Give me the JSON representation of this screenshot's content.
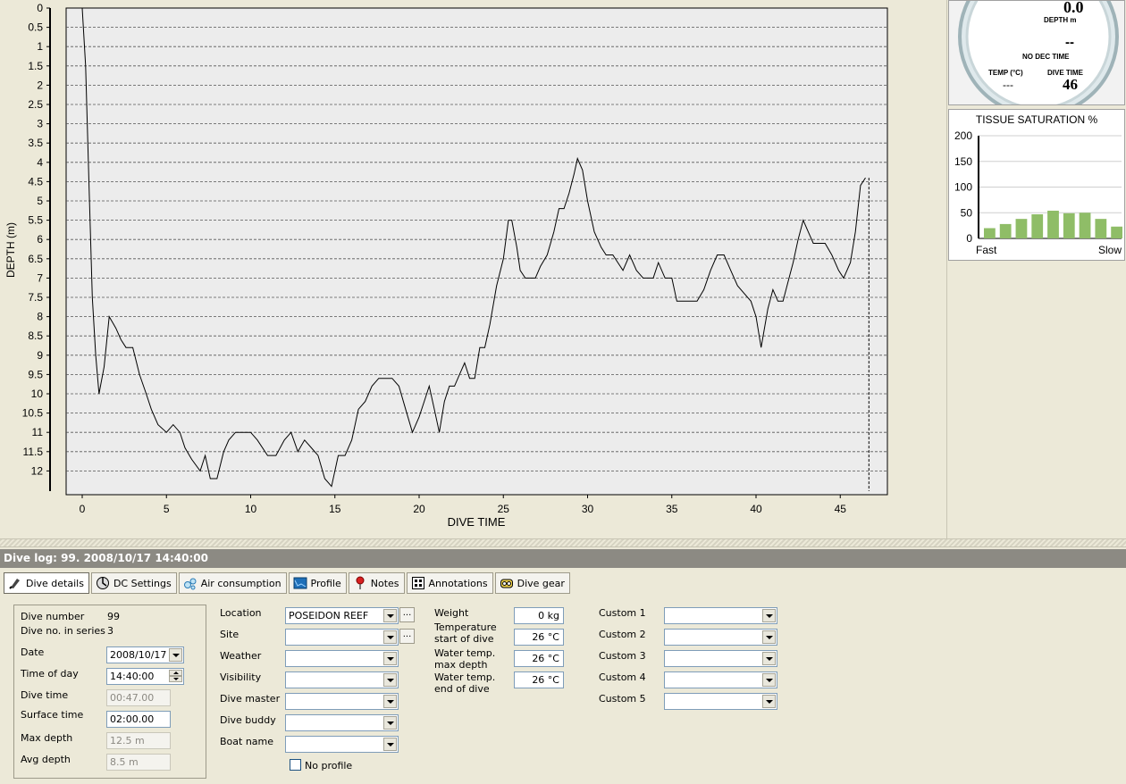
{
  "profile_chart": {
    "ylabel": "DEPTH (m)",
    "xlabel": "DIVE TIME",
    "ylim": [
      0,
      12.5
    ],
    "xlim": [
      -1,
      48
    ],
    "y_ticks": [
      "0",
      "0.5",
      "1",
      "1.5",
      "2",
      "2.5",
      "3",
      "3.5",
      "4",
      "4.5",
      "5",
      "5.5",
      "6",
      "6.5",
      "7",
      "7.5",
      "8",
      "8.5",
      "9",
      "9.5",
      "10",
      "10.5",
      "11",
      "11.5",
      "12"
    ],
    "x_ticks": [
      "0",
      "5",
      "10",
      "15",
      "20",
      "25",
      "30",
      "35",
      "40",
      "45"
    ],
    "fill_color": "#8f8ff0",
    "line_color": "#000000"
  },
  "chart_data": [
    {
      "type": "area",
      "title": "",
      "xlabel": "DIVE TIME",
      "ylabel": "DEPTH (m)",
      "ylim": [
        0,
        12.5
      ],
      "xlim": [
        0,
        47
      ],
      "x": [
        0.0,
        0.2,
        0.4,
        0.6,
        0.8,
        1.0,
        1.3,
        1.6,
        2.0,
        2.3,
        2.6,
        3.0,
        3.4,
        3.8,
        4.1,
        4.5,
        5.0,
        5.4,
        5.8,
        6.1,
        6.5,
        7.0,
        7.3,
        7.6,
        8.0,
        8.4,
        8.7,
        9.1,
        9.6,
        10.0,
        10.4,
        11.0,
        11.5,
        12.0,
        12.4,
        12.8,
        13.2,
        13.6,
        14.0,
        14.4,
        14.8,
        15.2,
        15.6,
        16.0,
        16.4,
        16.8,
        17.2,
        17.6,
        18.0,
        18.4,
        18.8,
        19.2,
        19.6,
        20.0,
        20.3,
        20.6,
        20.9,
        21.2,
        21.5,
        21.8,
        22.1,
        22.4,
        22.7,
        23.0,
        23.3,
        23.6,
        23.9,
        24.2,
        24.6,
        25.0,
        25.3,
        25.5,
        25.8,
        26.0,
        26.3,
        26.6,
        26.9,
        27.2,
        27.6,
        28.0,
        28.3,
        28.6,
        28.9,
        29.2,
        29.4,
        29.7,
        30.0,
        30.4,
        30.8,
        31.1,
        31.5,
        31.8,
        32.1,
        32.5,
        32.9,
        33.3,
        33.6,
        33.9,
        34.2,
        34.6,
        35.0,
        35.3,
        35.7,
        36.1,
        36.5,
        36.9,
        37.3,
        37.7,
        38.1,
        38.5,
        38.9,
        39.3,
        39.7,
        40.0,
        40.3,
        40.7,
        41.0,
        41.3,
        41.6,
        41.9,
        42.2,
        42.5,
        42.8,
        43.1,
        43.4,
        43.8,
        44.1,
        44.5,
        44.9,
        45.2,
        45.6,
        45.9,
        46.2,
        46.5,
        46.7
      ],
      "y": [
        0.0,
        1.5,
        4.5,
        7.5,
        9.0,
        10.0,
        9.3,
        8.0,
        8.3,
        8.6,
        8.8,
        8.8,
        9.5,
        10.0,
        10.4,
        10.8,
        11.0,
        10.8,
        11.0,
        11.4,
        11.7,
        12.0,
        11.6,
        12.2,
        12.2,
        11.5,
        11.2,
        11.0,
        11.0,
        11.0,
        11.2,
        11.6,
        11.6,
        11.2,
        11.0,
        11.5,
        11.2,
        11.4,
        11.6,
        12.2,
        12.4,
        11.6,
        11.6,
        11.2,
        10.4,
        10.2,
        9.8,
        9.6,
        9.6,
        9.6,
        9.8,
        10.4,
        11.0,
        10.6,
        10.2,
        9.8,
        10.4,
        11.0,
        10.2,
        9.8,
        9.8,
        9.5,
        9.2,
        9.6,
        9.6,
        8.8,
        8.8,
        8.2,
        7.2,
        6.5,
        5.5,
        5.5,
        6.2,
        6.8,
        7.0,
        7.0,
        7.0,
        6.7,
        6.4,
        5.8,
        5.2,
        5.2,
        4.8,
        4.3,
        3.9,
        4.2,
        5.0,
        5.8,
        6.2,
        6.4,
        6.4,
        6.6,
        6.8,
        6.4,
        6.8,
        7.0,
        7.0,
        7.0,
        6.6,
        7.0,
        7.0,
        7.6,
        7.6,
        7.6,
        7.6,
        7.3,
        6.8,
        6.4,
        6.4,
        6.8,
        7.2,
        7.4,
        7.6,
        8.0,
        8.8,
        7.8,
        7.3,
        7.6,
        7.6,
        7.1,
        6.6,
        6.0,
        5.5,
        5.8,
        6.1,
        6.1,
        6.1,
        6.4,
        6.8,
        7.0,
        6.6,
        5.8,
        4.6,
        4.4
      ]
    },
    {
      "type": "bar",
      "title": "TISSUE SATURATION %",
      "ylim": [
        0,
        200
      ],
      "categories": [
        "1",
        "2",
        "3",
        "4",
        "5",
        "6",
        "7",
        "8",
        "9"
      ],
      "values": [
        20,
        28,
        38,
        47,
        54,
        49,
        50,
        38,
        23
      ],
      "xlabel_left": "Fast",
      "xlabel_right": "Slow",
      "y_ticks": [
        "200",
        "150",
        "100",
        "50",
        "0"
      ],
      "bar_color": "#8fbd67"
    }
  ],
  "gauge": {
    "depth_value": "0.0",
    "depth_label": "DEPTH",
    "depth_unit": "m",
    "no_dec_value": "--",
    "no_dec_label": "NO DEC TIME",
    "temp_label": "TEMP (°C)",
    "temp_value": "---",
    "dive_time_label": "DIVE TIME",
    "dive_time_value": "46"
  },
  "tissue": {
    "title": "TISSUE SATURATION %",
    "fast": "Fast",
    "slow": "Slow"
  },
  "log_title": "Dive log: 99. 2008/10/17 14:40:00",
  "tabs": [
    {
      "label": "Dive details",
      "icon": "fin-icon"
    },
    {
      "label": "DC Settings",
      "icon": "dive-computer-icon"
    },
    {
      "label": "Air consumption",
      "icon": "bubbles-icon"
    },
    {
      "label": "Profile",
      "icon": "profile-icon"
    },
    {
      "label": "Notes",
      "icon": "pin-icon"
    },
    {
      "label": "Annotations",
      "icon": "annotations-icon"
    },
    {
      "label": "Dive gear",
      "icon": "mask-icon"
    }
  ],
  "details": {
    "dive_number_label": "Dive number",
    "dive_number": "99",
    "series_label": "Dive no. in series",
    "series": "3",
    "date_label": "Date",
    "date": "2008/10/17",
    "time_label": "Time of day",
    "time": "14:40:00",
    "dive_time_label": "Dive time",
    "dive_time": "00:47.00",
    "surface_label": "Surface time",
    "surface": "02:00.00",
    "max_depth_label": "Max depth",
    "max_depth": "12.5 m",
    "avg_depth_label": "Avg depth",
    "avg_depth": "8.5 m",
    "location_label": "Location",
    "location": "POSEIDON REEF",
    "site_label": "Site",
    "site": "",
    "weather_label": "Weather",
    "weather": "",
    "visibility_label": "Visibility",
    "visibility": "",
    "dive_master_label": "Dive master",
    "dive_master": "",
    "dive_buddy_label": "Dive buddy",
    "dive_buddy": "",
    "boat_label": "Boat name",
    "boat": "",
    "no_profile_label": "No profile",
    "weight_label": "Weight",
    "weight": "0 kg",
    "temp_start_label_1": "Temperature",
    "temp_start_label_2": "start of dive",
    "temp_start": "26 °C",
    "temp_max_label_1": "Water temp.",
    "temp_max_label_2": "max depth",
    "temp_max": "26 °C",
    "temp_end_label_1": "Water temp.",
    "temp_end_label_2": "end of dive",
    "temp_end": "26 °C",
    "custom1_label": "Custom 1",
    "custom2_label": "Custom 2",
    "custom3_label": "Custom 3",
    "custom4_label": "Custom 4",
    "custom5_label": "Custom 5"
  }
}
